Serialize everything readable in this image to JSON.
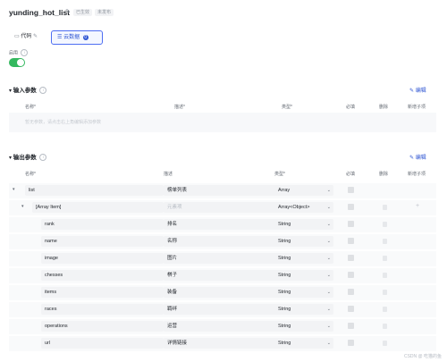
{
  "header": {
    "title": "yunding_hot_list",
    "tag_status": "已生效",
    "tag_version": "未发布"
  },
  "tabs": {
    "code_label": "代码",
    "code_suffix": "✎",
    "cloud_label": "云数据",
    "cloud_badge": "0"
  },
  "toggle": {
    "label": "启用",
    "on": true,
    "color": "#34b85f"
  },
  "input_section": {
    "title": "输入参数",
    "edit_label": "编辑",
    "columns": [
      "名称*",
      "描述*",
      "类型*",
      "必填",
      "删除",
      "新增子项"
    ],
    "placeholder": "暂无参数，请点击右上角编辑添加参数"
  },
  "output_section": {
    "title": "输出参数",
    "edit_label": "编辑",
    "columns": [
      "名称*",
      "描述",
      "类型*",
      "必填",
      "删除",
      "新增子项"
    ],
    "rows": [
      {
        "name": "list",
        "desc": "榜单列表",
        "type": "Array"
      },
      {
        "name": "[Array Item]",
        "desc": "元素项",
        "type": "Array<Object>"
      },
      {
        "name": "rank",
        "desc": "排名",
        "type": "String"
      },
      {
        "name": "name",
        "desc": "名称",
        "type": "String"
      },
      {
        "name": "image",
        "desc": "图片",
        "type": "String"
      },
      {
        "name": "chesses",
        "desc": "棋子",
        "type": "String"
      },
      {
        "name": "items",
        "desc": "装备",
        "type": "String"
      },
      {
        "name": "races",
        "desc": "羁绊",
        "type": "String"
      },
      {
        "name": "operations",
        "desc": "运营",
        "type": "String"
      },
      {
        "name": "url",
        "desc": "详情链接",
        "type": "String"
      }
    ]
  },
  "watermark": "CSDN @ 吃猫的鱼"
}
